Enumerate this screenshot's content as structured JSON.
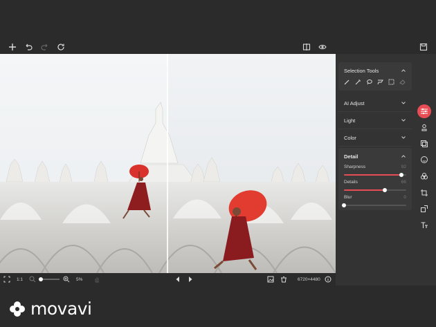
{
  "toolbar": {
    "icons": [
      "plus-icon",
      "undo-icon",
      "redo-icon",
      "rotate-icon",
      "compare-icon",
      "eye-icon",
      "save-icon"
    ]
  },
  "panel": {
    "selection_tools": {
      "title": "Selection Tools",
      "tools": [
        "brush-icon",
        "magic-wand-icon",
        "lasso-icon",
        "polygon-lasso-icon",
        "rect-select-icon",
        "eraser-icon"
      ]
    },
    "ai_adjust": "AI Adjust",
    "light": "Light",
    "color": "Color",
    "detail": {
      "title": "Detail",
      "sliders": [
        {
          "label": "Sharpness",
          "value": "92",
          "level": 0.92
        },
        {
          "label": "Details",
          "value": "66",
          "level": 0.66
        },
        {
          "label": "Blur",
          "value": "0",
          "level": 0.0
        }
      ]
    }
  },
  "bottom": {
    "one_to_one": "1:1",
    "zoom": "5%",
    "dimensions": "6720×4480"
  },
  "logo": {
    "text": "movavi"
  },
  "colors": {
    "accent": "#e84c55",
    "bg": "#2b2b2b",
    "panel": "#333333"
  }
}
